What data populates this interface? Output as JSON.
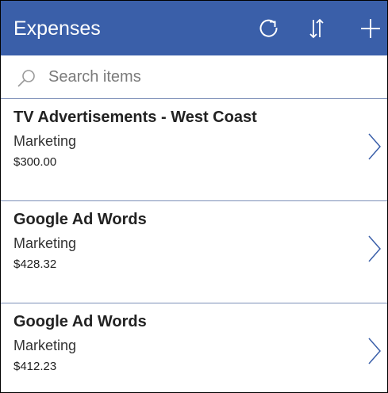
{
  "header": {
    "title": "Expenses",
    "actions": [
      {
        "name": "refresh",
        "icon": "refresh-icon"
      },
      {
        "name": "sort",
        "icon": "sort-icon"
      },
      {
        "name": "add",
        "icon": "plus-icon"
      }
    ],
    "color": "#3a5fa9"
  },
  "search": {
    "value": "",
    "placeholder": "Search items",
    "icon": "search-icon"
  },
  "items": [
    {
      "title": "TV Advertisements - West Coast",
      "category": "Marketing",
      "amount": "$300.00"
    },
    {
      "title": "Google Ad Words",
      "category": "Marketing",
      "amount": "$428.32"
    },
    {
      "title": "Google Ad Words",
      "category": "Marketing",
      "amount": "$412.23"
    }
  ],
  "colors": {
    "accent": "#3a5fa9",
    "divider": "#7c8fb8",
    "chevron": "#3a5fa9"
  }
}
